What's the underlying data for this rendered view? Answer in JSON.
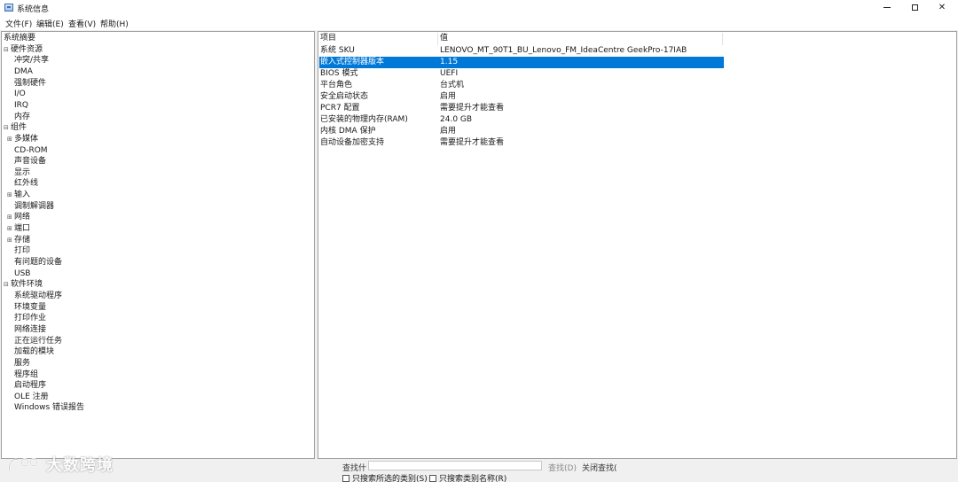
{
  "window": {
    "title": "系统信息"
  },
  "menu": [
    "文件(F)",
    "编辑(E)",
    "查看(V)",
    "帮助(H)"
  ],
  "tree": [
    {
      "label": "系统摘要",
      "level": 0
    },
    {
      "label": "硬件资源",
      "level": 0,
      "toggle": "⊟"
    },
    {
      "label": "冲突/共享",
      "level": 1
    },
    {
      "label": "DMA",
      "level": 1
    },
    {
      "label": "强制硬件",
      "level": 1
    },
    {
      "label": "I/O",
      "level": 1
    },
    {
      "label": "IRQ",
      "level": 1
    },
    {
      "label": "内存",
      "level": 1
    },
    {
      "label": "组件",
      "level": 0,
      "toggle": "⊟"
    },
    {
      "label": "多媒体",
      "level": 1,
      "toggle": "⊞"
    },
    {
      "label": "CD-ROM",
      "level": 1
    },
    {
      "label": "声音设备",
      "level": 1
    },
    {
      "label": "显示",
      "level": 1
    },
    {
      "label": "红外线",
      "level": 1
    },
    {
      "label": "输入",
      "level": 1,
      "toggle": "⊞"
    },
    {
      "label": "调制解调器",
      "level": 1
    },
    {
      "label": "网络",
      "level": 1,
      "toggle": "⊞"
    },
    {
      "label": "端口",
      "level": 1,
      "toggle": "⊞"
    },
    {
      "label": "存储",
      "level": 1,
      "toggle": "⊞"
    },
    {
      "label": "打印",
      "level": 1
    },
    {
      "label": "有问题的设备",
      "level": 1
    },
    {
      "label": "USB",
      "level": 1
    },
    {
      "label": "软件环境",
      "level": 0,
      "toggle": "⊟"
    },
    {
      "label": "系统驱动程序",
      "level": 1
    },
    {
      "label": "环境变量",
      "level": 1
    },
    {
      "label": "打印作业",
      "level": 1
    },
    {
      "label": "网络连接",
      "level": 1
    },
    {
      "label": "正在运行任务",
      "level": 1
    },
    {
      "label": "加载的模块",
      "level": 1
    },
    {
      "label": "服务",
      "level": 1
    },
    {
      "label": "程序组",
      "level": 1
    },
    {
      "label": "启动程序",
      "level": 1
    },
    {
      "label": "OLE 注册",
      "level": 1
    },
    {
      "label": "Windows 错误报告",
      "level": 1
    }
  ],
  "detail": {
    "headers": {
      "item": "项目",
      "value": "值"
    },
    "rows": [
      {
        "item": "系统 SKU",
        "value": "LENOVO_MT_90T1_BU_Lenovo_FM_IdeaCentre GeekPro-17IAB"
      },
      {
        "item": "嵌入式控制器版本",
        "value": "1.15",
        "selected": true
      },
      {
        "item": "BIOS 模式",
        "value": "UEFI"
      },
      {
        "item": "平台角色",
        "value": "台式机"
      },
      {
        "item": "安全启动状态",
        "value": "启用"
      },
      {
        "item": "PCR7 配置",
        "value": "需要提升才能查看"
      },
      {
        "item": "已安装的物理内存(RAM)",
        "value": "24.0 GB"
      },
      {
        "item": "内核 DMA 保护",
        "value": "启用"
      },
      {
        "item": "自动设备加密支持",
        "value": "需要提升才能查看"
      }
    ]
  },
  "find": {
    "label": "查找什",
    "find_button": "查找(D)",
    "close_find": "关闭查找(",
    "only_selected": "只搜索所选的类别(S)",
    "only_names": "只搜索类别名称(R)"
  },
  "watermark": {
    "text": "大数跨境"
  },
  "colors": {
    "selection": "#0078d7"
  }
}
